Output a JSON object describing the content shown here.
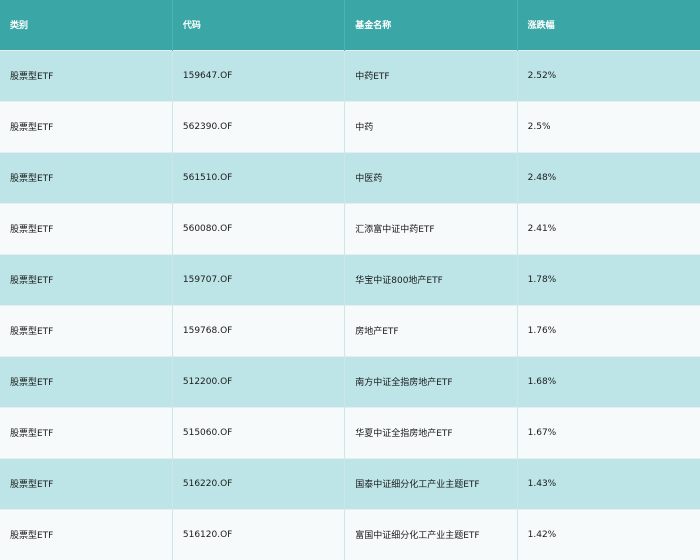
{
  "table": {
    "headers": [
      "类别",
      "代码",
      "基金名称",
      "涨跌幅"
    ],
    "rows": [
      [
        "股票型ETF",
        "159647.OF",
        "中药ETF",
        "2.52%"
      ],
      [
        "股票型ETF",
        "562390.OF",
        "中药",
        "2.5%"
      ],
      [
        "股票型ETF",
        "561510.OF",
        "中医药",
        "2.48%"
      ],
      [
        "股票型ETF",
        "560080.OF",
        "汇添富中证中药ETF",
        "2.41%"
      ],
      [
        "股票型ETF",
        "159707.OF",
        "华宝中证800地产ETF",
        "1.78%"
      ],
      [
        "股票型ETF",
        "159768.OF",
        "房地产ETF",
        "1.76%"
      ],
      [
        "股票型ETF",
        "512200.OF",
        "南方中证全指房地产ETF",
        "1.68%"
      ],
      [
        "股票型ETF",
        "515060.OF",
        "华夏中证全指房地产ETF",
        "1.67%"
      ],
      [
        "股票型ETF",
        "516220.OF",
        "国泰中证细分化工产业主题ETF",
        "1.43%"
      ],
      [
        "股票型ETF",
        "516120.OF",
        "富国中证细分化工产业主题ETF",
        "1.42%"
      ]
    ]
  }
}
